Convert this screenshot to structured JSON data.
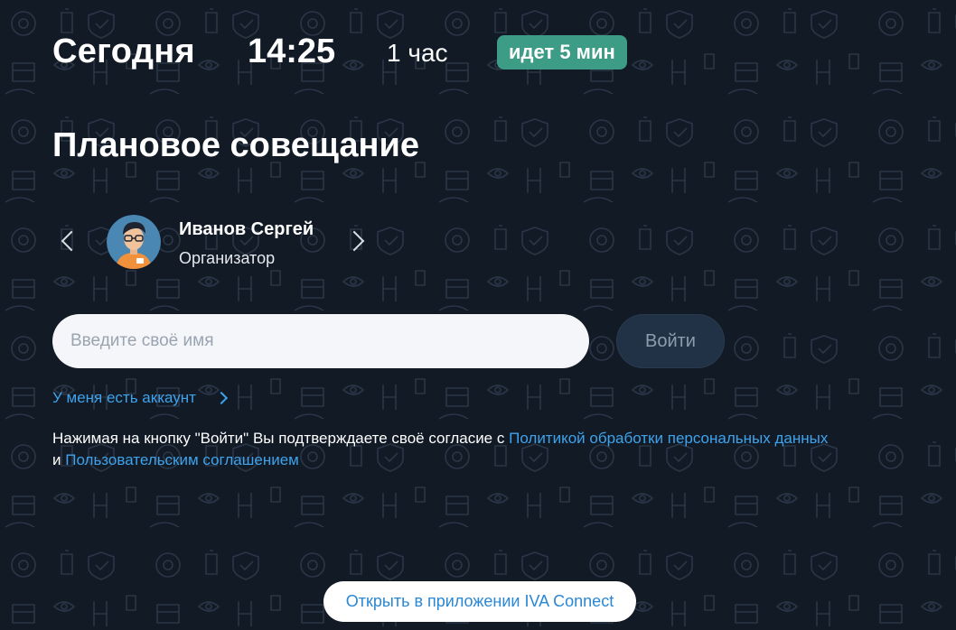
{
  "meeting": {
    "date": "Сегодня",
    "time": "14:25",
    "duration": "1 час",
    "status": "идет 5 мин",
    "title": "Плановое совещание"
  },
  "organizer": {
    "name": "Иванов Сергей",
    "role": "Организатор"
  },
  "join": {
    "name_placeholder": "Введите своё имя",
    "login_label": "Войти",
    "account_link": "У меня есть аккаунт"
  },
  "consent": {
    "text": "Нажимая на кнопку \"Войти\" Вы подтверждаете своё согласие с ",
    "privacy_link": "Политикой обработки персональных данных",
    "and": "и ",
    "terms_link": "Пользовательским соглашением"
  },
  "open_app_label": "Открыть в приложении IVA Connect",
  "colors": {
    "background": "#111a25",
    "badge": "#3d9c86",
    "link": "#3ea3ec",
    "button_disabled": "#223246"
  }
}
